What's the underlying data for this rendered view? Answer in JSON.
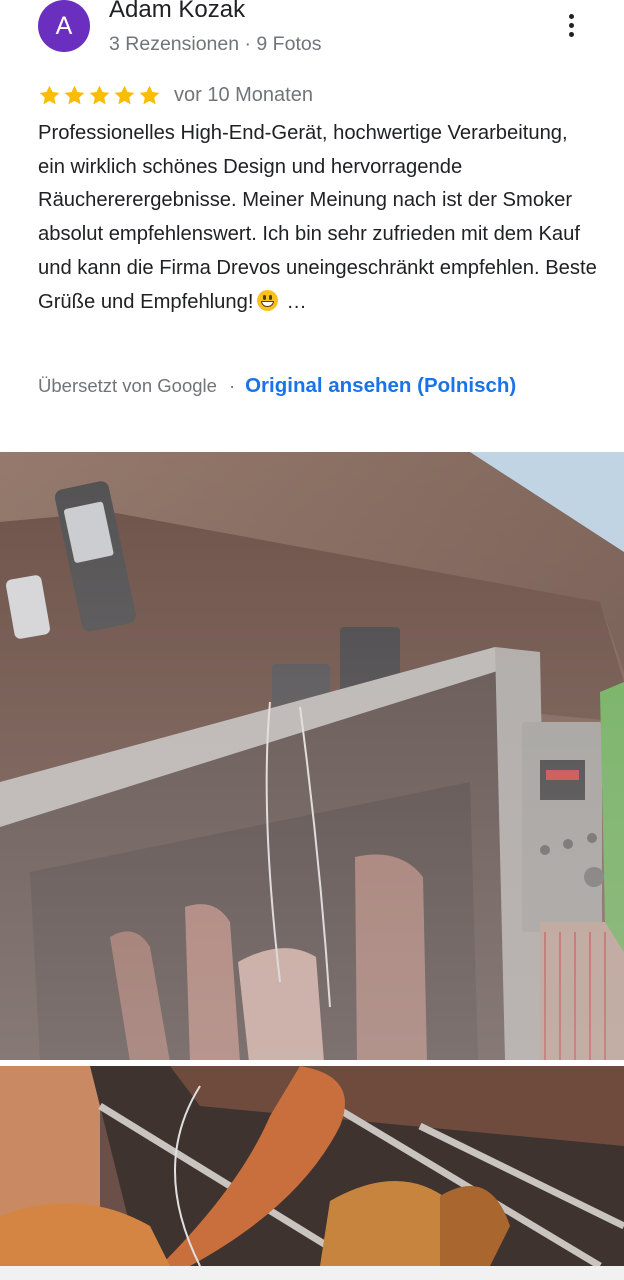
{
  "author": {
    "avatar_letter": "A",
    "avatar_color": "#6b2fc0",
    "name": "Adam Kozak",
    "meta": "3 Rezensionen · 9 Fotos"
  },
  "menu": {
    "icon": "more-vert-icon"
  },
  "rating": {
    "stars": 5,
    "max": 5,
    "star_color": "#fbbc04",
    "date": "vor 10 Monaten"
  },
  "review": {
    "text": "Professionelles High-End-Gerät, hochwertige Verarbeitung, ein wirklich schönes Design und hervorragende Räuchererergebnisse. Meiner Meinung nach ist der Smoker absolut empfehlenswert. Ich bin sehr zufrieden mit dem Kauf und kann die Firma Drevos uneingeschränkt empfehlen. Beste Grüße und Empfehlung!",
    "emoji": "grinning-face-emoji",
    "more": "…"
  },
  "translation": {
    "note": "Übersetzt von Google",
    "separator": "·",
    "link": "Original ansehen (Polnisch)",
    "link_color": "#1a73e8"
  },
  "photos": [
    {
      "subject": "smoker-cabinet-photo"
    },
    {
      "subject": "smoked-meat-closeup-photo"
    }
  ]
}
